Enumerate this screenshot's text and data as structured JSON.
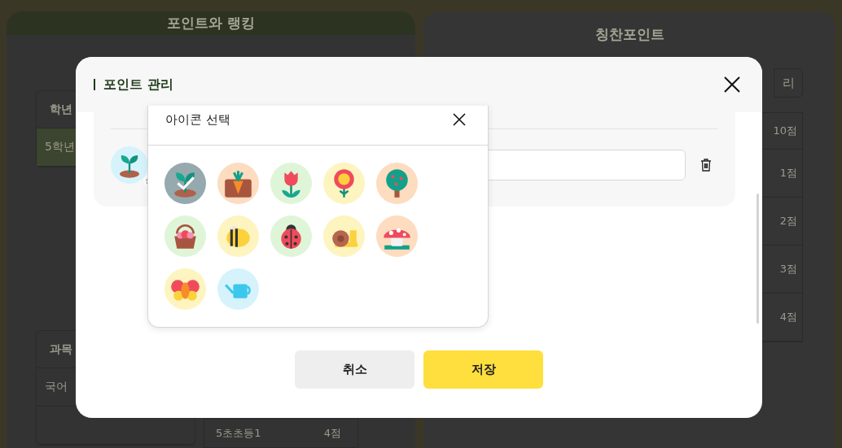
{
  "tabs": [
    {
      "label": "포인트와 랭킹",
      "selected": true
    },
    {
      "label": "칭찬포인트",
      "selected": false
    }
  ],
  "left_panel": {
    "table_1": {
      "header": "학년",
      "rows": [
        {
          "label": "5학년",
          "selected": true
        }
      ]
    },
    "table_2": {
      "header": "과목",
      "rows": [
        {
          "label": "국어"
        }
      ]
    },
    "list": [
      {
        "name": "5초초등1",
        "points": "4점"
      }
    ]
  },
  "right_panel": {
    "button": "리",
    "points": [
      "10점",
      "1점",
      "2점",
      "3점",
      "4점"
    ]
  },
  "modal": {
    "title": "포인트 관리"
  },
  "icon_picker": {
    "title": "아이콘 선택",
    "icons": [
      {
        "kind": "sprout",
        "color": "#95a9ae",
        "selected": true
      },
      {
        "kind": "carrot",
        "color": "#fddcc0",
        "selected": false
      },
      {
        "kind": "tulip",
        "color": "#dff5d8",
        "selected": false
      },
      {
        "kind": "flower",
        "color": "#fdf4c0",
        "selected": false
      },
      {
        "kind": "tree",
        "color": "#fddcc0",
        "selected": false
      },
      {
        "kind": "basket",
        "color": "#dff5d8",
        "selected": false
      },
      {
        "kind": "bee",
        "color": "#fdf4c0",
        "selected": false
      },
      {
        "kind": "ladybug",
        "color": "#dff5d8",
        "selected": false
      },
      {
        "kind": "snail",
        "color": "#fdf4c0",
        "selected": false
      },
      {
        "kind": "mushroom",
        "color": "#fddcc0",
        "selected": false
      },
      {
        "kind": "butterfly",
        "color": "#fdf4c0",
        "selected": false
      },
      {
        "kind": "watering-can",
        "color": "#d6f3fb",
        "selected": false
      }
    ]
  },
  "buttons": [
    {
      "label": "취소",
      "kind": "cancel"
    },
    {
      "label": "저장",
      "kind": "primary"
    }
  ]
}
